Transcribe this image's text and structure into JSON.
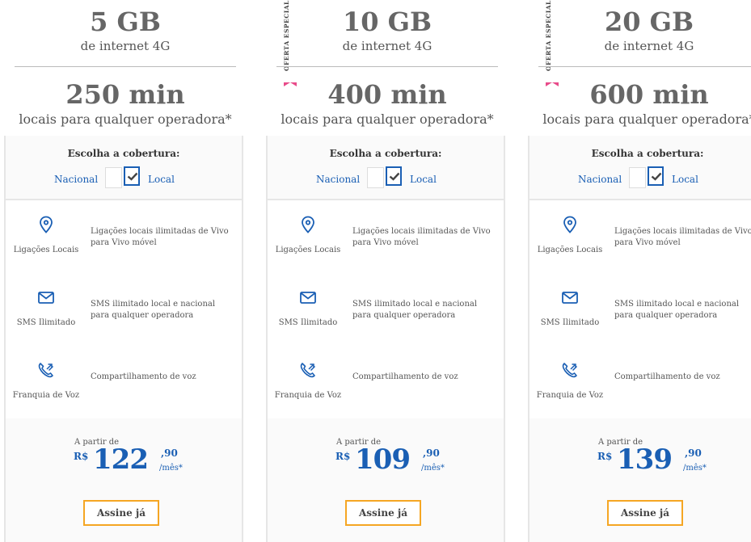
{
  "plans": [
    {
      "data": "5 GB",
      "data_sub": "de internet 4G",
      "minutes": "250 min",
      "minutes_sub": "locais para qualquer operadora*",
      "ribbon": "",
      "coverage_title": "Escolha a cobertura:",
      "coverage_nacional": "Nacional",
      "coverage_local": "Local",
      "features": [
        {
          "icon": "location-pin-icon",
          "label": "Ligações Locais",
          "desc": "Ligações locais ilimitadas de Vivo para Vivo móvel"
        },
        {
          "icon": "envelope-icon",
          "label": "SMS Ilimitado",
          "desc": "SMS ilimitado local e nacional para qualquer operadora"
        },
        {
          "icon": "phone-voice-icon",
          "label": "Franquia de Voz",
          "desc": "Compartilhamento de voz"
        }
      ],
      "price_from": "A partir de",
      "currency": "R$",
      "price_int": "122",
      "price_dec": ",90",
      "per": "/mês*",
      "cta": "Assine já"
    },
    {
      "data": "10 GB",
      "data_sub": "de internet 4G",
      "minutes": "400 min",
      "minutes_sub": "locais para qualquer operadora*",
      "ribbon": "OFERTA ESPECIAL",
      "coverage_title": "Escolha a cobertura:",
      "coverage_nacional": "Nacional",
      "coverage_local": "Local",
      "features": [
        {
          "icon": "location-pin-icon",
          "label": "Ligações Locais",
          "desc": "Ligações locais ilimitadas de Vivo para Vivo móvel"
        },
        {
          "icon": "envelope-icon",
          "label": "SMS Ilimitado",
          "desc": "SMS ilimitado local e nacional para qualquer operadora"
        },
        {
          "icon": "phone-voice-icon",
          "label": "Franquia de Voz",
          "desc": "Compartilhamento de voz"
        }
      ],
      "price_from": "A partir de",
      "currency": "R$",
      "price_int": "109",
      "price_dec": ",90",
      "per": "/mês*",
      "cta": "Assine já"
    },
    {
      "data": "20 GB",
      "data_sub": "de internet 4G",
      "minutes": "600 min",
      "minutes_sub": "locais para qualquer operadora*",
      "ribbon": "OFERTA ESPECIAL",
      "coverage_title": "Escolha a cobertura:",
      "coverage_nacional": "Nacional",
      "coverage_local": "Local",
      "features": [
        {
          "icon": "location-pin-icon",
          "label": "Ligações Locais",
          "desc": "Ligações locais ilimitadas de Vivo para Vivo móvel"
        },
        {
          "icon": "envelope-icon",
          "label": "SMS Ilimitado",
          "desc": "SMS ilimitado local e nacional para qualquer operadora"
        },
        {
          "icon": "phone-voice-icon",
          "label": "Franquia de Voz",
          "desc": "Compartilhamento de voz"
        }
      ],
      "price_from": "A partir de",
      "currency": "R$",
      "price_int": "139",
      "price_dec": ",90",
      "per": "/mês*",
      "cta": "Assine já"
    }
  ],
  "colors": {
    "accent": "#1a5fb4",
    "cta_border": "#f5a623",
    "ribbon": "#e84b8a"
  }
}
